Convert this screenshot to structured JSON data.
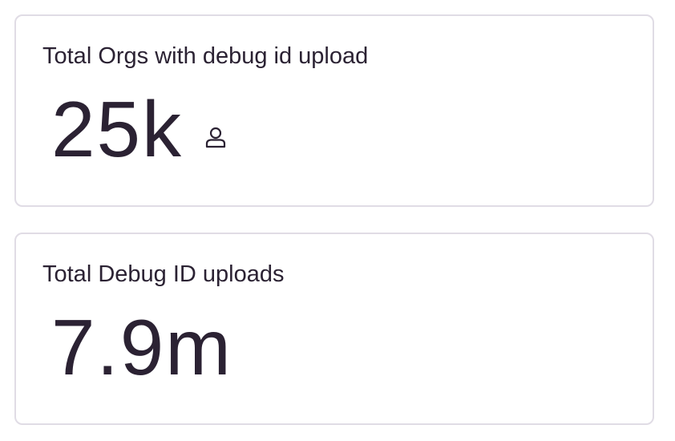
{
  "cards": [
    {
      "title": "Total Orgs with debug id upload",
      "value": "25k",
      "unit_icon": "user-icon"
    },
    {
      "title": "Total Debug ID uploads",
      "value": "7.9m"
    }
  ],
  "colors": {
    "text": "#2b2233",
    "border": "#e0dce5",
    "background": "#ffffff"
  }
}
